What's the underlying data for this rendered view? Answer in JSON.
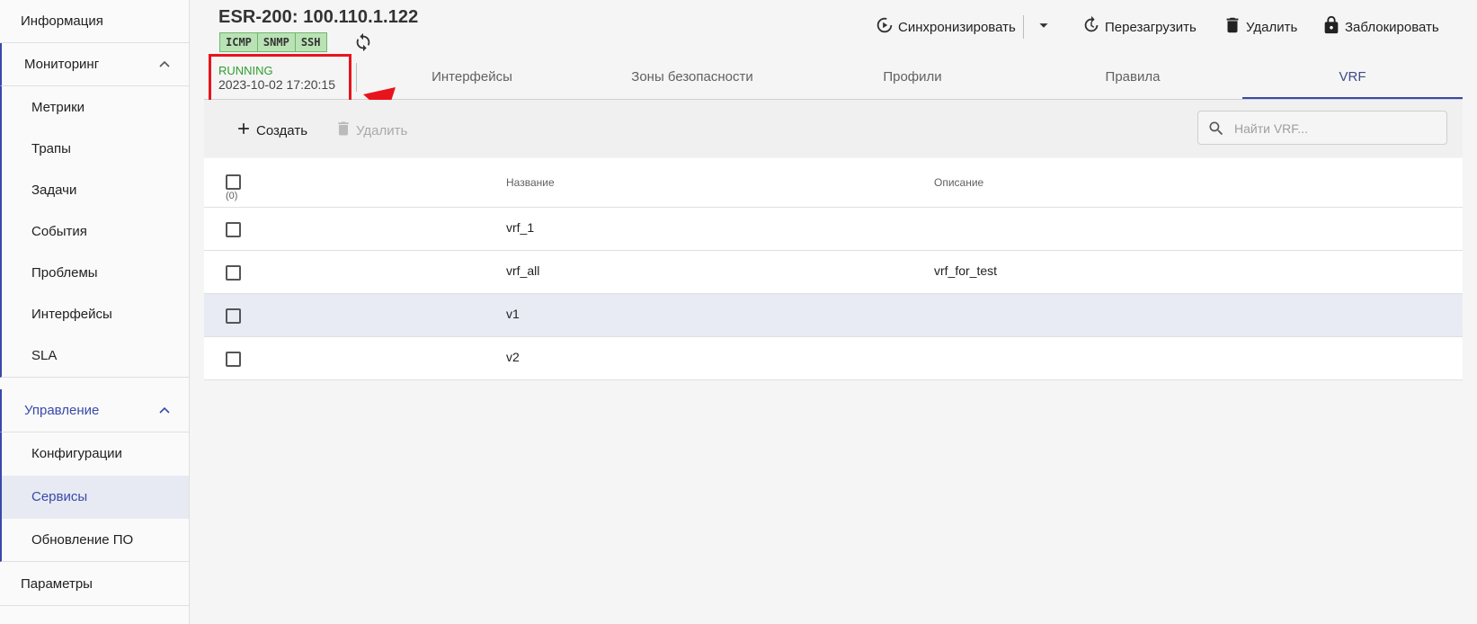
{
  "sidebar": {
    "info": "Информация",
    "monitoring": {
      "label": "Мониторинг",
      "items": [
        "Метрики",
        "Трапы",
        "Задачи",
        "События",
        "Проблемы",
        "Интерфейсы",
        "SLA"
      ]
    },
    "management": {
      "label": "Управление",
      "items": [
        "Конфигурации",
        "Сервисы",
        "Обновление ПО"
      ],
      "selected": "Сервисы"
    },
    "params": "Параметры"
  },
  "header": {
    "title": "ESR-200: 100.110.1.122",
    "badges": [
      "ICMP",
      "SNMP",
      "SSH"
    ],
    "actions": {
      "sync": "Синхронизировать",
      "reboot": "Перезагрузить",
      "delete": "Удалить",
      "lock": "Заблокировать"
    }
  },
  "status": {
    "state": "RUNNING",
    "timestamp": "2023-10-02 17:20:15"
  },
  "tabs": [
    "Интерфейсы",
    "Зоны безопасности",
    "Профили",
    "Правила",
    "VRF"
  ],
  "active_tab": "VRF",
  "toolbar": {
    "create": "Создать",
    "delete": "Удалить",
    "search_placeholder": "Найти VRF..."
  },
  "table": {
    "selected_count": "(0)",
    "columns": [
      "Название",
      "Описание"
    ],
    "rows": [
      {
        "name": "vrf_1",
        "description": ""
      },
      {
        "name": "vrf_all",
        "description": "vrf_for_test"
      },
      {
        "name": "v1",
        "description": ""
      },
      {
        "name": "v2",
        "description": ""
      }
    ]
  },
  "colors": {
    "accent": "#3949ab",
    "running": "#2e9e2e",
    "annotation": "#e8141c",
    "badge_bg": "#b9e3b5"
  }
}
